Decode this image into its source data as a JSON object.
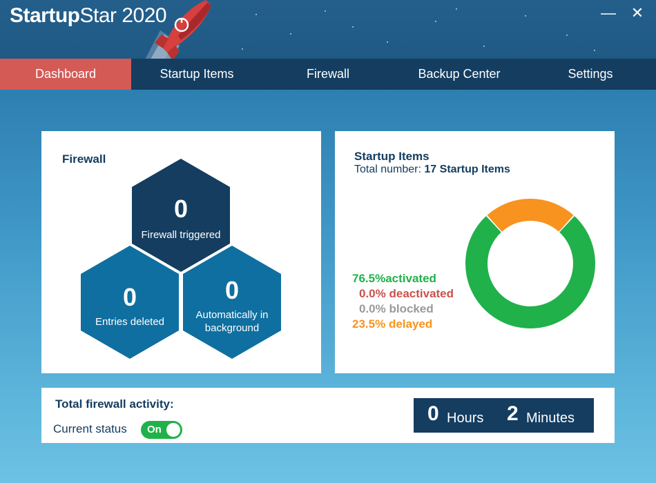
{
  "app": {
    "title_bold": "Startup",
    "title_light": "Star 2020"
  },
  "window": {
    "minimize": "—",
    "close": "✕"
  },
  "nav": {
    "items": [
      {
        "label": "Dashboard",
        "active": true
      },
      {
        "label": "Startup Items",
        "active": false
      },
      {
        "label": "Firewall",
        "active": false
      },
      {
        "label": "Backup Center",
        "active": false
      },
      {
        "label": "Settings",
        "active": false
      }
    ]
  },
  "firewall": {
    "title": "Firewall",
    "hexes": [
      {
        "value": "0",
        "label": "Firewall triggered"
      },
      {
        "value": "0",
        "label": "Entries deleted"
      },
      {
        "value": "0",
        "label": "Automatically in background"
      }
    ]
  },
  "startup": {
    "title": "Startup Items",
    "total_prefix": "Total number:",
    "total_count": "17",
    "total_suffix": "Startup Items",
    "legend": [
      {
        "pct": "76.5%",
        "label": "activated",
        "color": "#20b14a"
      },
      {
        "pct": "0.0%",
        "label": "deactivated",
        "color": "#c9524c"
      },
      {
        "pct": "0.0%",
        "label": "blocked",
        "color": "#9a9a9a"
      },
      {
        "pct": "23.5%",
        "label": "delayed",
        "color": "#f7931e"
      }
    ],
    "donut": [
      {
        "fraction": 0.765,
        "color": "#20b14a"
      },
      {
        "fraction": 0.235,
        "color": "#f7931e"
      }
    ]
  },
  "activity": {
    "title": "Total firewall activity:",
    "status_label": "Current status",
    "toggle_label": "On",
    "hours_value": "0",
    "hours_unit": "Hours",
    "minutes_value": "2",
    "minutes_unit": "Minutes"
  },
  "colors": {
    "accent": "#d45a55",
    "navy": "#143d60",
    "hex_dark": "#143d60",
    "hex_mid": "#0f6fa0"
  }
}
